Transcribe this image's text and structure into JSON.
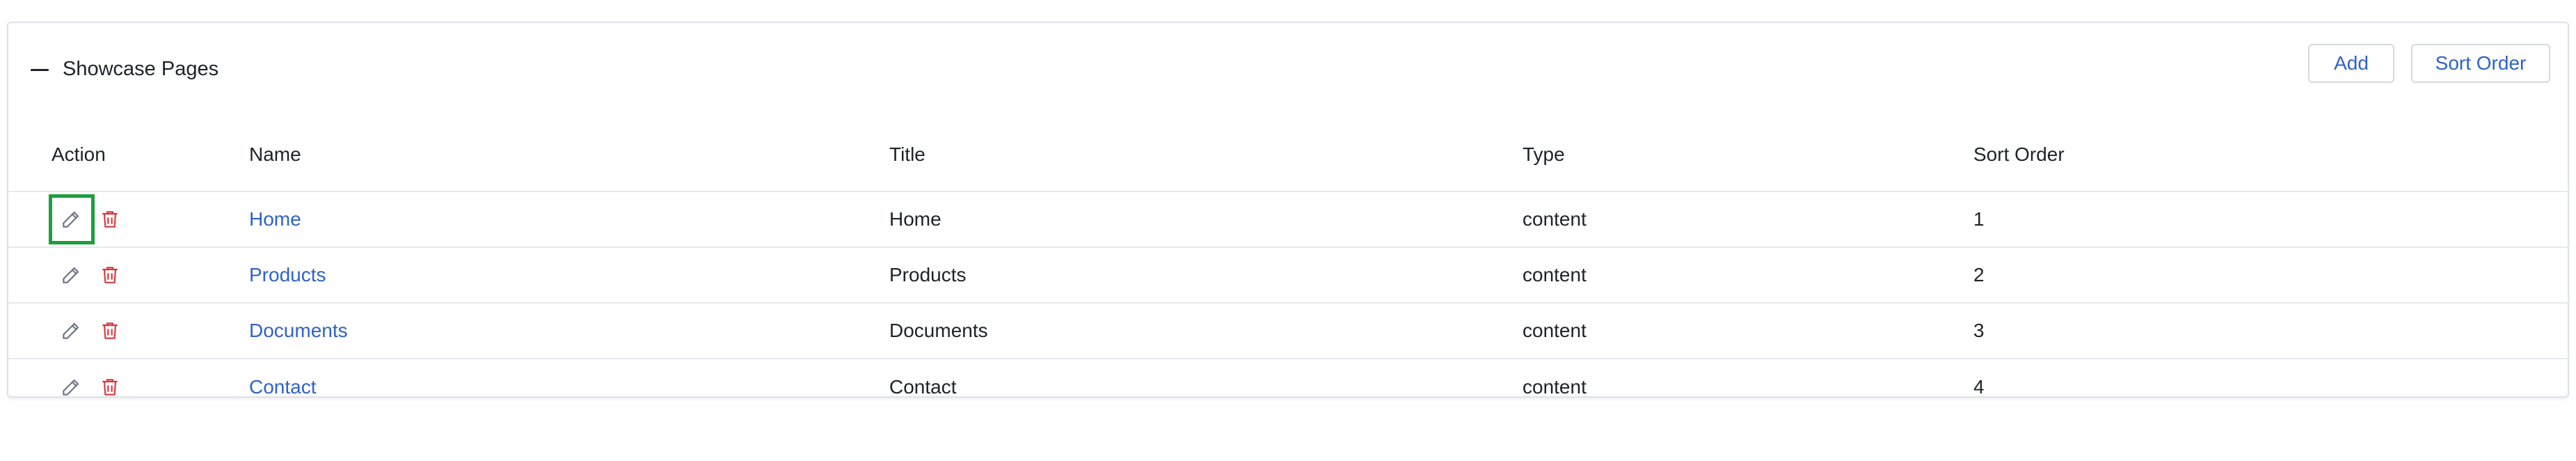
{
  "panel": {
    "title": "Showcase Pages",
    "add_label": "Add",
    "sort_order_label": "Sort Order"
  },
  "table": {
    "headers": {
      "action": "Action",
      "name": "Name",
      "title": "Title",
      "type": "Type",
      "sort_order": "Sort Order"
    },
    "rows": [
      {
        "name": "Home",
        "title": "Home",
        "type": "content",
        "sort_order": "1"
      },
      {
        "name": "Products",
        "title": "Products",
        "type": "content",
        "sort_order": "2"
      },
      {
        "name": "Documents",
        "title": "Documents",
        "type": "content",
        "sort_order": "3"
      },
      {
        "name": "Contact",
        "title": "Contact",
        "type": "content",
        "sort_order": "4"
      }
    ]
  },
  "icons": {
    "collapse": "minus-icon",
    "edit": "pencil-icon",
    "delete": "trash-icon"
  },
  "colors": {
    "link": "#2f62c8",
    "delete": "#d9363e",
    "edit": "#6b7280",
    "focus": "#1e9e3e"
  }
}
